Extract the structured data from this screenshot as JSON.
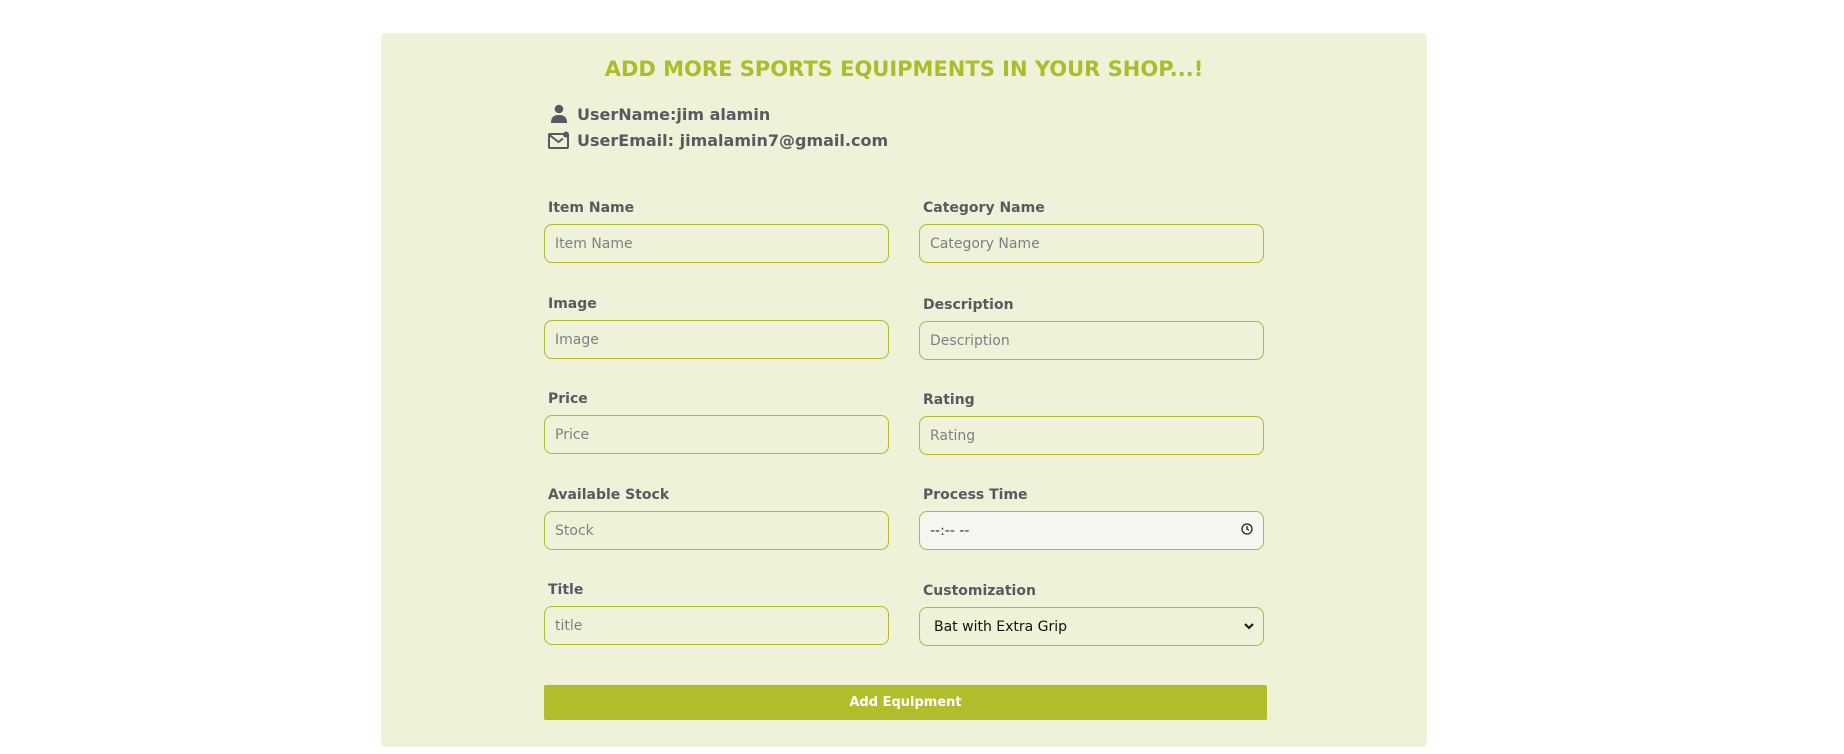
{
  "form": {
    "heading": "ADD MORE SPORTS EQUIPMENTS IN YOUR SHOP...!",
    "user_name_line": "UserName:jim alamin",
    "user_email_line": "UserEmail: jimalamin7@gmail.com",
    "fields": {
      "item_name": {
        "label": "Item Name",
        "placeholder": "Item Name"
      },
      "category_name": {
        "label": "Category Name",
        "placeholder": "Category Name"
      },
      "image": {
        "label": "Image",
        "placeholder": "Image"
      },
      "description": {
        "label": "Description",
        "placeholder": "Description"
      },
      "price": {
        "label": "Price",
        "placeholder": "Price"
      },
      "rating": {
        "label": "Rating",
        "placeholder": "Rating"
      },
      "available_stock": {
        "label": "Available Stock",
        "placeholder": "Stock"
      },
      "process_time": {
        "label": "Process Time",
        "value": "--:-- --"
      },
      "title": {
        "label": "Title",
        "placeholder": "title"
      },
      "customization": {
        "label": "Customization",
        "selected": "Bat with Extra Grip"
      }
    },
    "submit_label": "Add Equipment"
  },
  "colors": {
    "accent": "#b2bd2c",
    "card_bg": "#eef2d8",
    "text": "#555b63"
  },
  "icons": {
    "user": "user-icon",
    "email": "envelope-icon",
    "clock": "clock-icon",
    "chevron": "chevron-down-icon"
  }
}
